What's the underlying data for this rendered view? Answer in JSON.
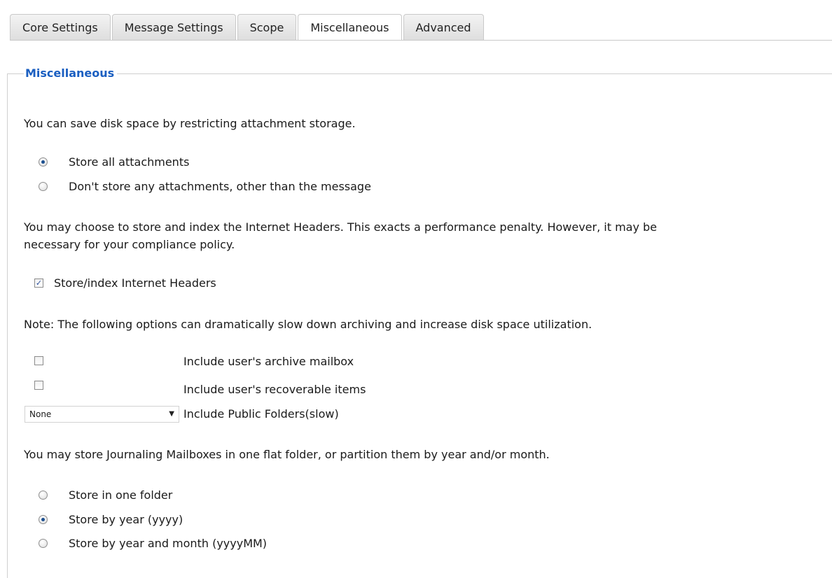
{
  "tabs": [
    {
      "label": "Core Settings"
    },
    {
      "label": "Message Settings"
    },
    {
      "label": "Scope"
    },
    {
      "label": "Miscellaneous"
    },
    {
      "label": "Advanced"
    }
  ],
  "active_tab": "Miscellaneous",
  "section": {
    "legend": "Miscellaneous"
  },
  "attachments": {
    "intro": "You can save disk space by restricting attachment storage.",
    "options": [
      {
        "label": "Store all attachments",
        "checked": true
      },
      {
        "label": "Don't store any attachments, other than the message",
        "checked": false
      }
    ]
  },
  "headers": {
    "intro_line1": "You may choose to store and index the Internet Headers. This exacts a performance penalty. However, it may be",
    "intro_line2": "necessary for your compliance policy.",
    "checkbox_label": "Store/index Internet Headers",
    "checked": true
  },
  "note": "Note: The following options can dramatically slow down archiving and increase disk space utilization.",
  "options": {
    "archive_label": "Include user's archive mailbox",
    "archive_checked": false,
    "recoverable_label": "Include user's recoverable items",
    "recoverable_checked": false,
    "public_folders_label": "Include Public Folders(slow)",
    "public_folders_value": "None"
  },
  "journaling": {
    "intro": "You may store Journaling Mailboxes in one flat folder, or partition them by year and/or month.",
    "options": [
      {
        "label": "Store in one folder",
        "checked": false
      },
      {
        "label": "Store by year (yyyy)",
        "checked": true
      },
      {
        "label": "Store by year and month (yyyyMM)",
        "checked": false
      }
    ]
  },
  "icons": {
    "dropdown": "chevron-down-icon",
    "check": "check-icon"
  }
}
